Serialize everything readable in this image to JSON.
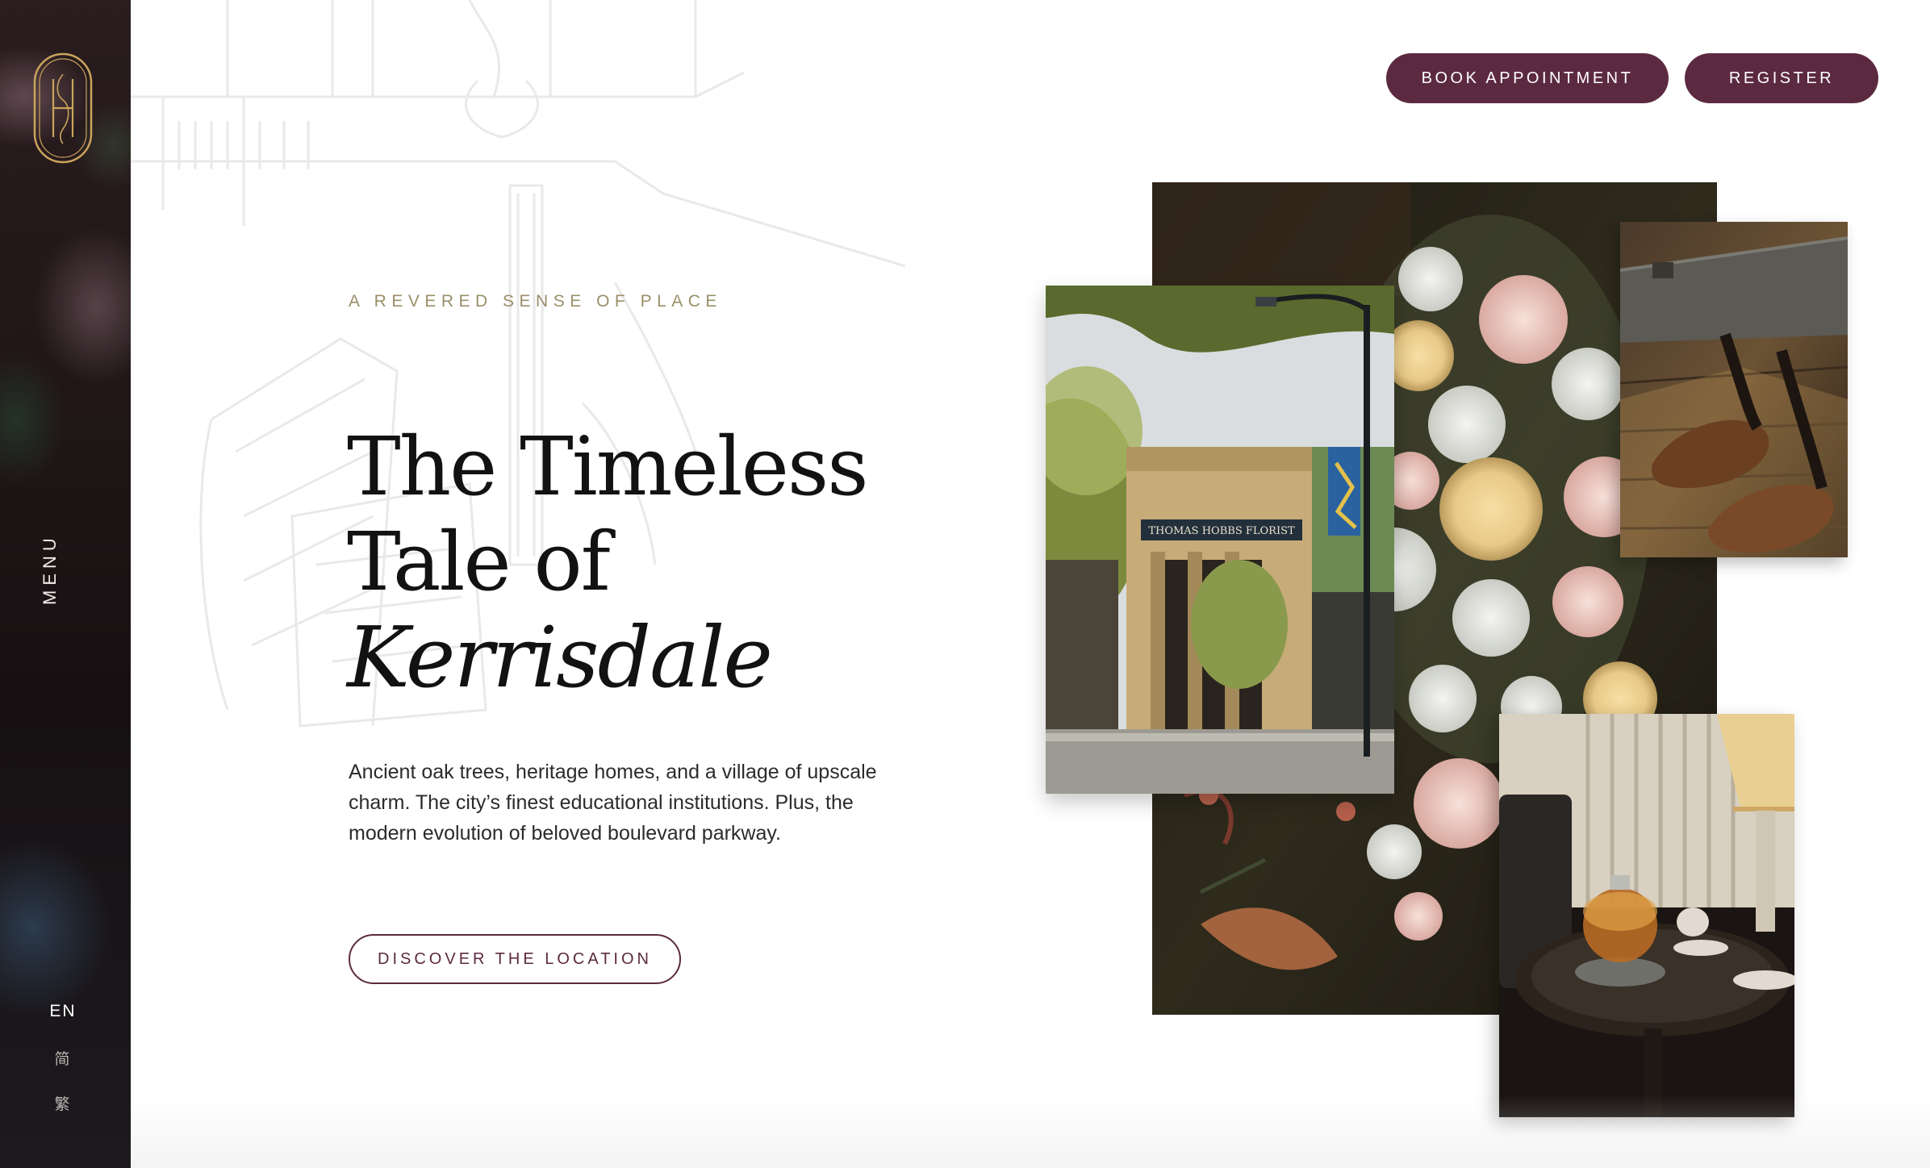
{
  "sidebar": {
    "menu_label": "MENU",
    "languages": [
      "EN",
      "简",
      "繁"
    ]
  },
  "header": {
    "book_label": "BOOK APPOINTMENT",
    "register_label": "REGISTER"
  },
  "hero": {
    "eyebrow": "A REVERED SENSE OF PLACE",
    "headline_line1": "The Timeless",
    "headline_line2": "Tale of",
    "headline_line3": "Kerrisdale",
    "body": "Ancient oak trees, heritage homes, and a village of upscale charm. The city’s finest educational institutions. Plus, the modern evolution of beloved boulevard parkway.",
    "cta_label": "DISCOVER THE LOCATION"
  },
  "storefront_sign": "THOMAS HOBBS FLORIST",
  "colors": {
    "brand_plum": "#5c2a40",
    "eyebrow_gold": "#9a8f6a",
    "logo_gold": "#c9a45c"
  }
}
